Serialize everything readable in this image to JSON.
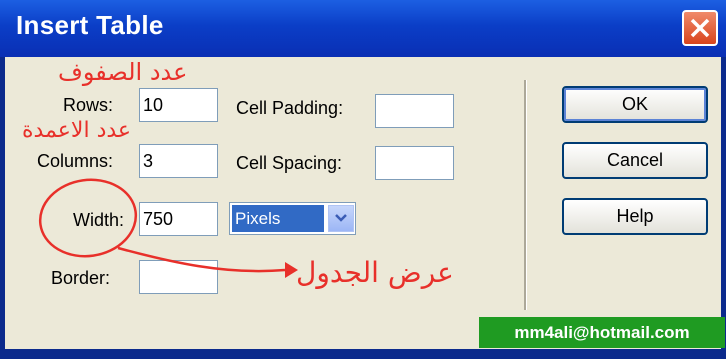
{
  "window": {
    "title": "Insert Table"
  },
  "form": {
    "rows": {
      "label": "Rows:",
      "value": "10"
    },
    "columns": {
      "label": "Columns:",
      "value": "3"
    },
    "width": {
      "label": "Width:",
      "value": "750",
      "unit": "Pixels"
    },
    "border": {
      "label": "Border:",
      "value": ""
    },
    "cell_padding": {
      "label": "Cell Padding:",
      "value": ""
    },
    "cell_spacing": {
      "label": "Cell Spacing:",
      "value": ""
    }
  },
  "buttons": {
    "ok": "OK",
    "cancel": "Cancel",
    "help": "Help"
  },
  "annotations": {
    "rows_note": "عدد الصفوف",
    "columns_note": "عدد الاعمدة",
    "width_note": "عرض الجدول"
  },
  "watermark": "mm4ali@hotmail.com",
  "colors": {
    "title_bar": "#0b3ec7",
    "dialog_bg": "#ece9d8",
    "annotation": "#e8302a",
    "watermark_bg": "#1f9b22"
  }
}
